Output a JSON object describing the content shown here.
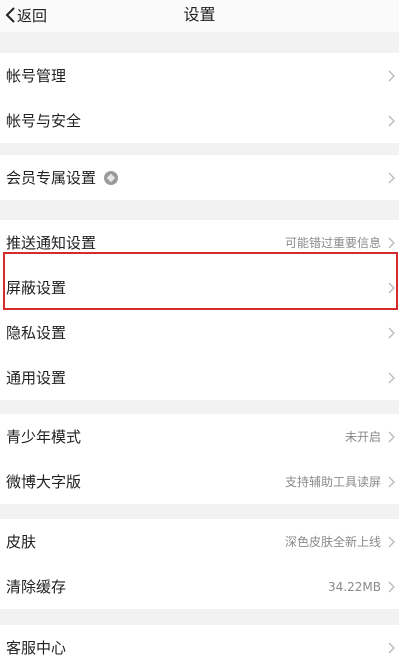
{
  "nav": {
    "back_label": "返回",
    "title": "设置"
  },
  "groups": [
    {
      "items": [
        {
          "label": "帐号管理",
          "value": ""
        },
        {
          "label": "帐号与安全",
          "value": ""
        }
      ]
    },
    {
      "items": [
        {
          "label": "会员专属设置",
          "value": "",
          "icon": "vip-diamond-icon"
        }
      ]
    },
    {
      "items": [
        {
          "label": "推送通知设置",
          "value": "可能错过重要信息"
        },
        {
          "label": "屏蔽设置",
          "value": ""
        },
        {
          "label": "隐私设置",
          "value": ""
        },
        {
          "label": "通用设置",
          "value": ""
        }
      ]
    },
    {
      "items": [
        {
          "label": "青少年模式",
          "value": "未开启"
        },
        {
          "label": "微博大字版",
          "value": "支持辅助工具读屏"
        }
      ]
    },
    {
      "items": [
        {
          "label": "皮肤",
          "value": "深色皮肤全新上线"
        },
        {
          "label": "清除缓存",
          "value": "34.22MB"
        }
      ]
    },
    {
      "items": [
        {
          "label": "客服中心",
          "value": ""
        }
      ]
    }
  ],
  "colors": {
    "highlight_border": "#d62b2b",
    "background": "#f2f2f2",
    "row_background": "#ffffff",
    "secondary_text": "#8a8a8a"
  }
}
